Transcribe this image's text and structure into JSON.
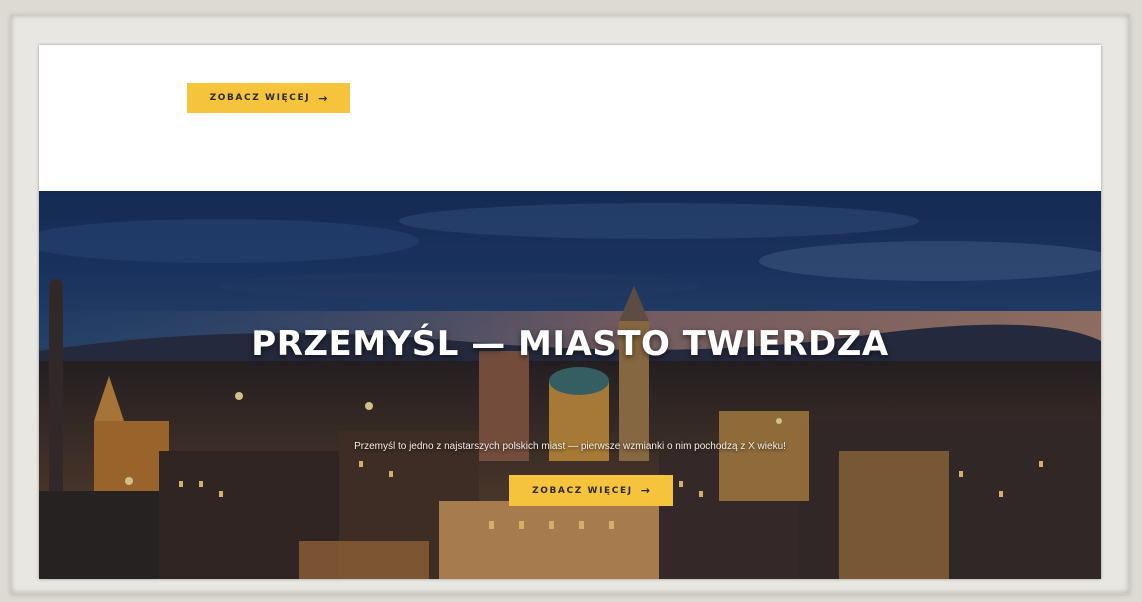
{
  "top_section": {
    "button_label": "ZOBACZ WIĘCEJ",
    "button_icon": "arrow-right-icon"
  },
  "hero": {
    "title": "PRZEMYŚL — MIASTO TWIERDZA",
    "subtitle": "Przemyśl to jedno z najstarszych polskich miast — pierwsze wzmianki o nim pochodzą z X wieku!",
    "button_label": "ZOBACZ WIĘCEJ",
    "button_icon": "arrow-right-icon"
  },
  "colors": {
    "accent": "#f6c33c",
    "hero_sky": "#1d3a6c",
    "page_bg": "#ffffff"
  }
}
